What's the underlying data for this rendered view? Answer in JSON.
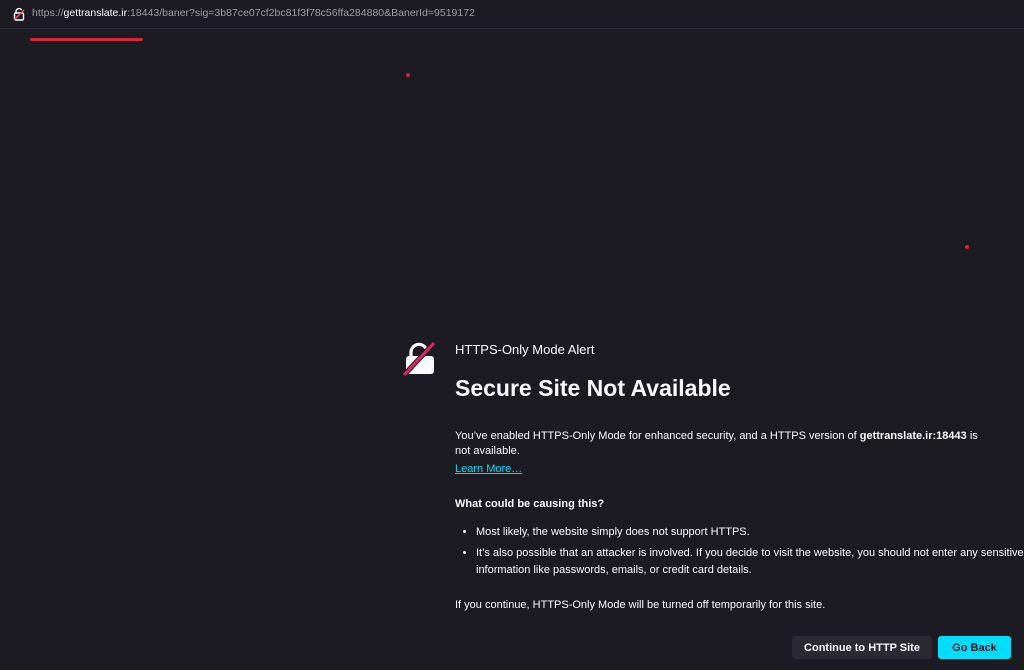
{
  "urlbar": {
    "url_scheme": "https://",
    "url_host": "gettranslate.ir",
    "url_rest": ":18443/baner?sig=3b87ce07cf2bc81f3f78c56ffa284880&BanerId=9519172",
    "icon": "broken-lock-icon"
  },
  "alert": {
    "icon": "broken-lock-icon",
    "subtitle": "HTTPS-Only Mode Alert",
    "title": "Secure Site Not Available",
    "desc_before": "You’ve enabled HTTPS-Only Mode for enhanced security, and a HTTPS version of ",
    "desc_host": "gettranslate.ir:18443",
    "desc_after": " is not available.",
    "learn_more": "Learn More…",
    "cause_heading": "What could be causing this?",
    "causes": [
      "Most likely, the website simply does not support HTTPS.",
      "It’s also possible that an attacker is involved. If you decide to visit the website, you should not enter any sensitive information like passwords, emails, or credit card details."
    ],
    "continue_note": "If you continue, HTTPS-Only Mode will be turned off temporarily for this site."
  },
  "buttons": {
    "continue_label": "Continue to HTTP Site",
    "back_label": "Go Back"
  },
  "colors": {
    "background": "#1c1b22",
    "accent": "#00ddff",
    "annotation_red": "#d7263d"
  }
}
